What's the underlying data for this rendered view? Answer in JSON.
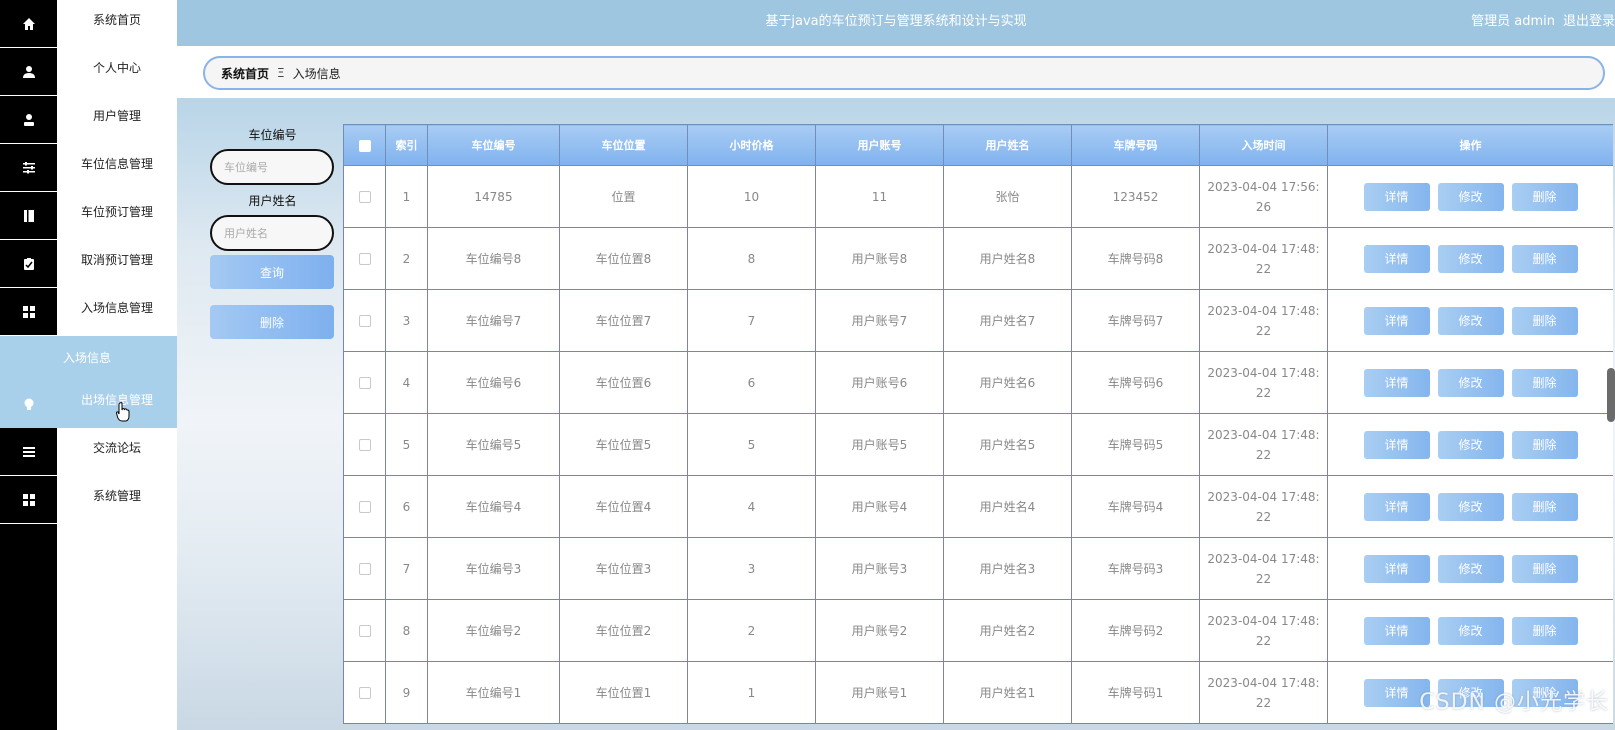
{
  "header": {
    "title": "基于java的车位预订与管理系统和设计与实现",
    "user_label": "管理员 admin",
    "logout_label": "退出登录"
  },
  "sidebar": {
    "items": [
      {
        "label": "系统首页",
        "icon": "home-icon"
      },
      {
        "label": "个人中心",
        "icon": "user-icon"
      },
      {
        "label": "用户管理",
        "icon": "user-manage-icon"
      },
      {
        "label": "车位信息管理",
        "icon": "sliders-icon"
      },
      {
        "label": "车位预订管理",
        "icon": "book-icon"
      },
      {
        "label": "取消预订管理",
        "icon": "clipboard-icon"
      },
      {
        "label": "入场信息管理",
        "icon": "grid-icon"
      },
      {
        "label": "出场信息管理",
        "icon": "bulb-icon"
      },
      {
        "label": "交流论坛",
        "icon": "list-icon"
      },
      {
        "label": "系统管理",
        "icon": "grid-icon"
      }
    ],
    "sub_item": "入场信息"
  },
  "breadcrumb": {
    "home": "系统首页",
    "separator": "Ξ",
    "current": "入场信息"
  },
  "search": {
    "field1_label": "车位编号",
    "field1_placeholder": "车位编号",
    "field2_label": "用户姓名",
    "field2_placeholder": "用户姓名",
    "query_label": "查询",
    "delete_label": "删除"
  },
  "table": {
    "headers": [
      "索引",
      "车位编号",
      "车位位置",
      "小时价格",
      "用户账号",
      "用户姓名",
      "车牌号码",
      "入场时间",
      "操作"
    ],
    "action_labels": {
      "detail": "详情",
      "edit": "修改",
      "delete": "删除"
    },
    "rows": [
      {
        "index": "1",
        "code": "14785",
        "location": "位置",
        "price": "10",
        "account": "11",
        "name": "张怡",
        "plate": "123452",
        "time": "2023-04-04 17:56:26"
      },
      {
        "index": "2",
        "code": "车位编号8",
        "location": "车位位置8",
        "price": "8",
        "account": "用户账号8",
        "name": "用户姓名8",
        "plate": "车牌号码8",
        "time": "2023-04-04 17:48:22"
      },
      {
        "index": "3",
        "code": "车位编号7",
        "location": "车位位置7",
        "price": "7",
        "account": "用户账号7",
        "name": "用户姓名7",
        "plate": "车牌号码7",
        "time": "2023-04-04 17:48:22"
      },
      {
        "index": "4",
        "code": "车位编号6",
        "location": "车位位置6",
        "price": "6",
        "account": "用户账号6",
        "name": "用户姓名6",
        "plate": "车牌号码6",
        "time": "2023-04-04 17:48:22"
      },
      {
        "index": "5",
        "code": "车位编号5",
        "location": "车位位置5",
        "price": "5",
        "account": "用户账号5",
        "name": "用户姓名5",
        "plate": "车牌号码5",
        "time": "2023-04-04 17:48:22"
      },
      {
        "index": "6",
        "code": "车位编号4",
        "location": "车位位置4",
        "price": "4",
        "account": "用户账号4",
        "name": "用户姓名4",
        "plate": "车牌号码4",
        "time": "2023-04-04 17:48:22"
      },
      {
        "index": "7",
        "code": "车位编号3",
        "location": "车位位置3",
        "price": "3",
        "account": "用户账号3",
        "name": "用户姓名3",
        "plate": "车牌号码3",
        "time": "2023-04-04 17:48:22"
      },
      {
        "index": "8",
        "code": "车位编号2",
        "location": "车位位置2",
        "price": "2",
        "account": "用户账号2",
        "name": "用户姓名2",
        "plate": "车牌号码2",
        "time": "2023-04-04 17:48:22"
      },
      {
        "index": "9",
        "code": "车位编号1",
        "location": "车位位置1",
        "price": "1",
        "account": "用户账号1",
        "name": "用户姓名1",
        "plate": "车牌号码1",
        "time": "2023-04-04 17:48:22"
      }
    ]
  },
  "watermark": "CSDN @小光学长",
  "colors": {
    "accent": "#9fc6e1",
    "button": "#84b5ee",
    "sidebar_icons_bg": "#000000"
  }
}
